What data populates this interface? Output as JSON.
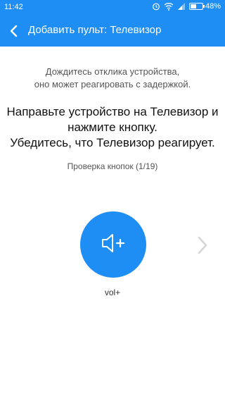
{
  "status_bar": {
    "time": "11:42",
    "battery": "48%",
    "battery_level": 0.48,
    "icons": [
      "alarm-icon",
      "wifi-icon",
      "signal-icon",
      "battery-icon"
    ]
  },
  "app_bar": {
    "title": "Добавить пульт: Телевизор",
    "back_icon": "arrow-left-icon"
  },
  "wait_message": {
    "line1": "Дождитесь отклика устройства,",
    "line2": "оно может реагировать с задержкой."
  },
  "instruction": {
    "line1": "Направьте устройство на Телевизор и",
    "line2": "нажмите кнопку.",
    "line3": "Убедитесь, что Телевизор реагирует."
  },
  "progress": "Проверка кнопок (1/19)",
  "button": {
    "label": "vol+",
    "icon": "volume-up-icon"
  },
  "next_icon": "chevron-right-icon",
  "colors": {
    "accent": "#1e8ef5",
    "chevron": "#d6d6d6"
  }
}
